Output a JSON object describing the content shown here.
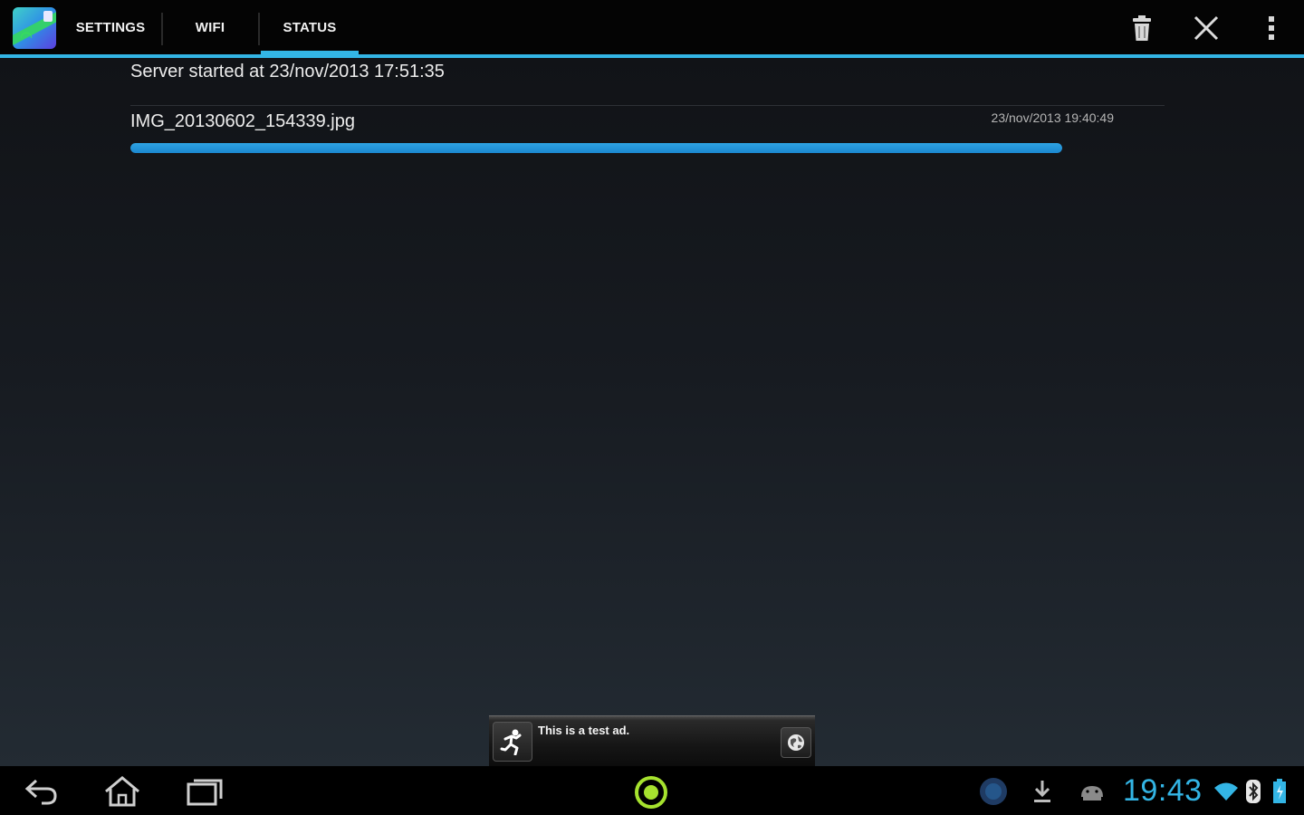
{
  "action_bar": {
    "tabs": [
      {
        "label": "SETTINGS"
      },
      {
        "label": "WIFI"
      },
      {
        "label": "STATUS",
        "selected": true
      }
    ],
    "actions": [
      "trash-icon",
      "close-icon",
      "overflow-menu-icon"
    ],
    "accent_color": "#33b5e5"
  },
  "status": {
    "server_line": "Server started at 23/nov/2013 17:51:35",
    "transfers": [
      {
        "file_name": "IMG_20130602_154339.jpg",
        "timestamp": "23/nov/2013 19:40:49",
        "progress_fraction": 1.0
      }
    ]
  },
  "ad": {
    "text": "This is a test ad."
  },
  "system_bar": {
    "clock": "19:43",
    "nav_buttons": [
      "back-icon",
      "home-icon",
      "recents-icon"
    ],
    "tray_icons": [
      "circle-app-icon",
      "download-icon",
      "android-icon",
      "wifi-icon",
      "bluetooth-icon",
      "battery-icon"
    ]
  }
}
